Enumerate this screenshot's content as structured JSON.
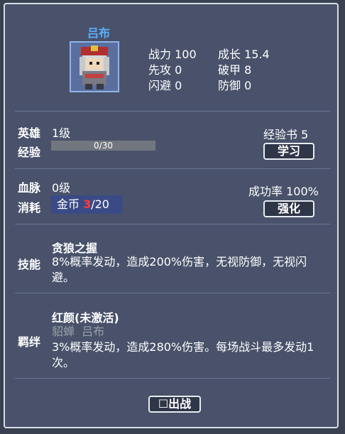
{
  "hero": {
    "name": "吕布",
    "stats": [
      {
        "label": "战力",
        "value": "100"
      },
      {
        "label": "成长",
        "value": "15.4"
      },
      {
        "label": "先攻",
        "value": "0"
      },
      {
        "label": "破甲",
        "value": "8"
      },
      {
        "label": "闪避",
        "value": "0"
      },
      {
        "label": "防御",
        "value": "0"
      }
    ]
  },
  "level": {
    "hero_label": "英雄",
    "hero_level": "1级",
    "exp_label": "经验",
    "exp_text": "0/30",
    "exp_progress": 0,
    "book_label": "经验书 5",
    "learn_button": "学习"
  },
  "bloodline": {
    "label": "血脉",
    "level": "0级",
    "cost_label": "消耗",
    "cost_prefix": "金币 ",
    "cost_have": "3",
    "cost_need": "/20",
    "success_rate": "成功率 100%",
    "strengthen_button": "强化"
  },
  "skill": {
    "label": "技能",
    "title": "贪狼之握",
    "desc": "8%概率发动，造成200%伤害，无视防御，无视闪避。"
  },
  "bond": {
    "label": "羁绊",
    "title": "红颜(未激活)",
    "members": "貂蝉  吕布",
    "desc": "3%概率发动，造成280%伤害。每场战斗最多发动1次。"
  },
  "deploy": {
    "checkbox_glyph": "☐",
    "label": "出战"
  }
}
